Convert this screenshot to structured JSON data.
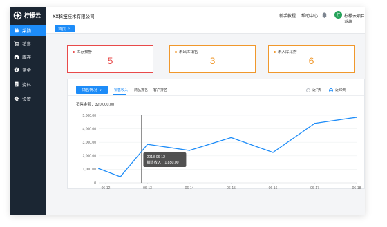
{
  "app": {
    "name": "柠檬云"
  },
  "sidebar": {
    "items": [
      {
        "label": "采购",
        "icon": "bag-icon",
        "active": true
      },
      {
        "label": "销售",
        "icon": "cart-icon",
        "active": false
      },
      {
        "label": "库存",
        "icon": "warehouse-icon",
        "active": false
      },
      {
        "label": "资金",
        "icon": "money-icon",
        "active": false
      },
      {
        "label": "资料",
        "icon": "document-icon",
        "active": false
      },
      {
        "label": "设置",
        "icon": "gear-icon",
        "active": false
      }
    ]
  },
  "header": {
    "company_bold": "XX科技",
    "company_rest": "技术有限公司",
    "links": [
      "新手教程",
      "帮助中心"
    ],
    "user_avatar_text": "柠",
    "user_name": "柠檬云项目系统"
  },
  "tabs": {
    "home_label": "首页",
    "close_symbol": "×"
  },
  "cards": [
    {
      "title": "库存预警",
      "value": "5",
      "color": "#e84a4a"
    },
    {
      "title": "未出库销售",
      "value": "3",
      "color": "#f0982c"
    },
    {
      "title": "未入库采购",
      "value": "6",
      "color": "#f0982c"
    }
  ],
  "panel": {
    "dropdown_label": "销售情况",
    "tabs": [
      "销售收入",
      "商品排名",
      "客户排名"
    ],
    "active_tab": 0,
    "ranges": [
      {
        "label": "近7天",
        "selected": false
      },
      {
        "label": "近30天",
        "selected": true
      }
    ],
    "total_label": "销售金额：320,000.00"
  },
  "chart_data": {
    "type": "line",
    "categories": [
      "06-12",
      "06-13",
      "06-14",
      "06-15",
      "06-16",
      "06-17",
      "06-18"
    ],
    "x": [
      "06-12",
      "06-12",
      "06-13",
      "06-14",
      "06-15",
      "06-16",
      "06-17",
      "06-18"
    ],
    "y_ticks": [
      "5,000.00",
      "4,000.00",
      "3,000.00",
      "2,000.00",
      "1,000.00",
      "0"
    ],
    "ylim": [
      0,
      5000
    ],
    "series": [
      {
        "values": [
          1050,
          450,
          2850,
          2400,
          3350,
          2250,
          4400,
          4850
        ],
        "color": "#1d8cf8"
      }
    ],
    "tooltip": {
      "date": "2018-06-12",
      "label": "销售收入：1,850.00"
    },
    "grid": true
  }
}
